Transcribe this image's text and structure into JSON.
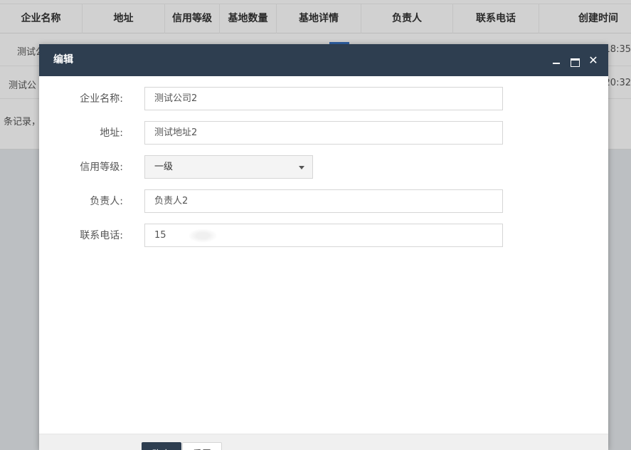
{
  "table": {
    "headers": [
      "企业名称",
      "地址",
      "信用等级",
      "基地数量",
      "基地详情",
      "负责人",
      "联系电话",
      "创建时间"
    ],
    "rows": [
      {
        "name_partial": "测试公",
        "time_partial": "18:35"
      },
      {
        "name_partial": "测试公",
        "time_partial": "20:32"
      }
    ],
    "footer_text": "条记录，"
  },
  "dialog": {
    "title": "编辑",
    "fields": {
      "company": {
        "label": "企业名称:",
        "value": "测试公司2"
      },
      "address": {
        "label": "地址:",
        "value": "测试地址2"
      },
      "credit": {
        "label": "信用等级:",
        "value": "一级"
      },
      "manager": {
        "label": "负责人:",
        "value": "负责人2"
      },
      "phone": {
        "label": "联系电话:",
        "value": "15"
      }
    },
    "buttons": {
      "confirm": "确定",
      "reset": "重置"
    }
  },
  "colors": {
    "header_bg": "#2e3e50",
    "accent": "#3a77c8",
    "overlay": "rgba(0,0,0,0.18)"
  },
  "icons": {
    "minimize": "minimize-icon",
    "maximize": "maximize-icon",
    "close": "close-icon",
    "dropdown": "chevron-down-icon"
  }
}
